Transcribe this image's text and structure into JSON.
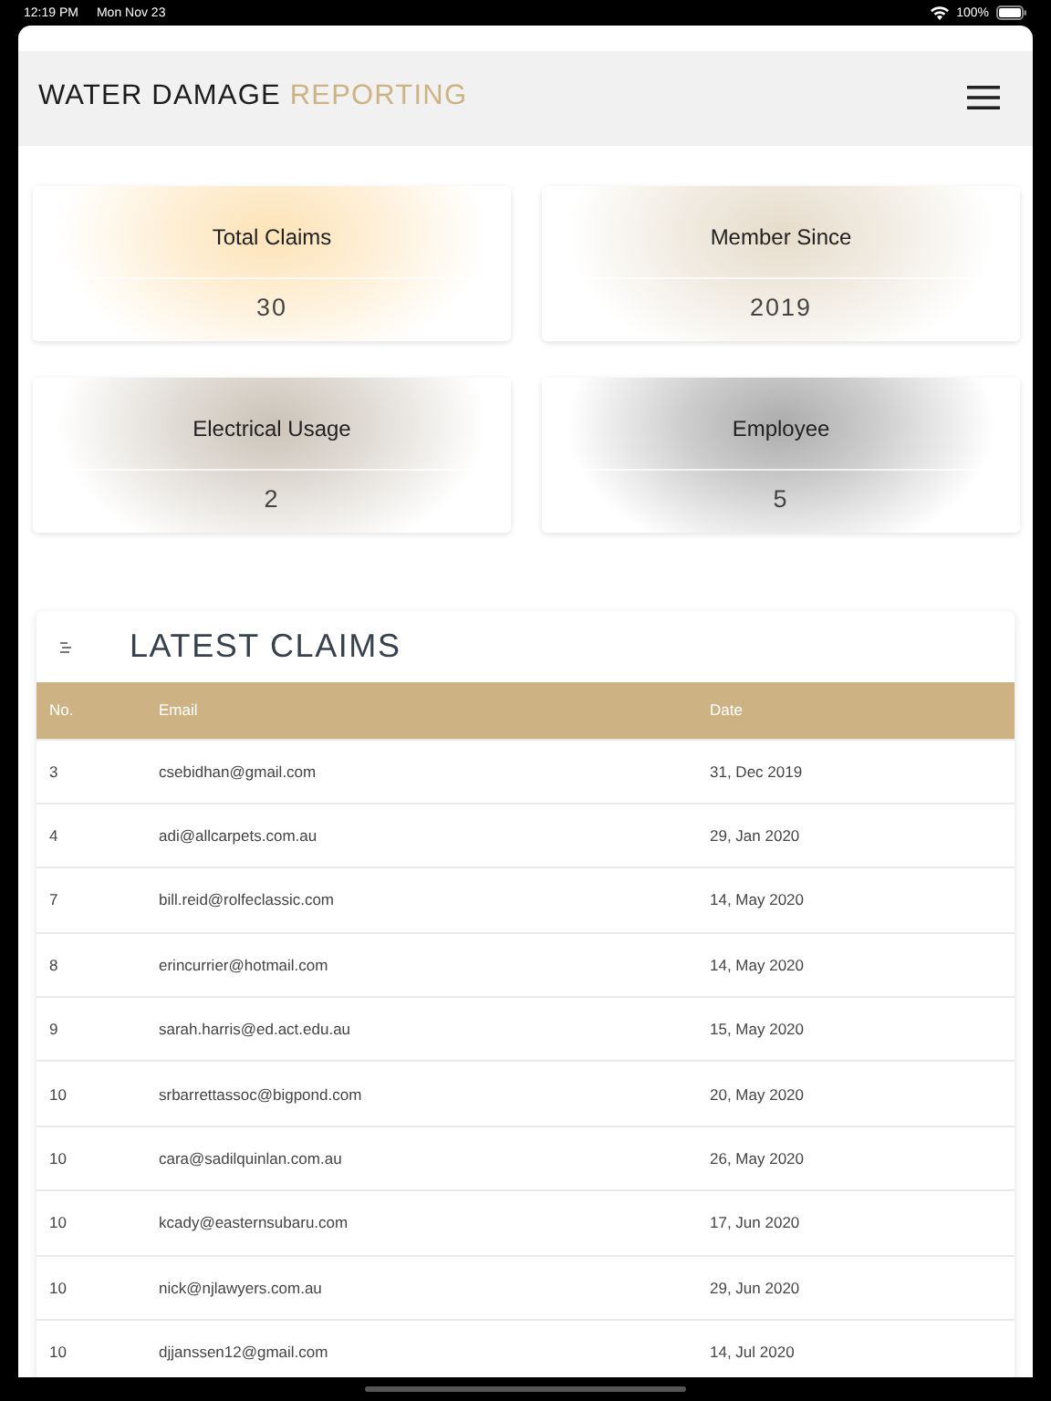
{
  "status_bar": {
    "time": "12:19 PM",
    "date": "Mon Nov 23",
    "battery": "100%"
  },
  "header": {
    "title": "WATER DAMAGE",
    "title_accent": "REPORTING"
  },
  "stats": [
    {
      "label": "Total Claims",
      "value": "30",
      "color": "#fde3b8"
    },
    {
      "label": "Member Since",
      "value": "2019",
      "color": "#e6dccb"
    },
    {
      "label": "Electrical Usage",
      "value": "2",
      "color": "#cbc3b8"
    },
    {
      "label": "Employee",
      "value": "5",
      "color": "#acacac"
    }
  ],
  "claims": {
    "title": "LATEST CLAIMS",
    "columns": [
      "No.",
      "Email",
      "Date"
    ],
    "rows": [
      [
        "3",
        "csebidhan@gmail.com",
        "31, Dec 2019"
      ],
      [
        "4",
        "adi@allcarpets.com.au",
        "29, Jan 2020"
      ],
      [
        "7",
        "bill.reid@rolfeclassic.com",
        "14, May 2020"
      ],
      [
        "8",
        "erincurrier@hotmail.com",
        "14, May 2020"
      ],
      [
        "9",
        "sarah.harris@ed.act.edu.au",
        "15, May 2020"
      ],
      [
        "10",
        "srbarrettassoc@bigpond.com",
        "20, May 2020"
      ],
      [
        "10",
        "cara@sadilquinlan.com.au",
        "26, May 2020"
      ],
      [
        "10",
        "kcady@easternsubaru.com",
        "17, Jun 2020"
      ],
      [
        "10",
        "nick@njlawyers.com.au",
        "29, Jun 2020"
      ],
      [
        "10",
        "djjanssen12@gmail.com",
        "14, Jul 2020"
      ]
    ]
  }
}
